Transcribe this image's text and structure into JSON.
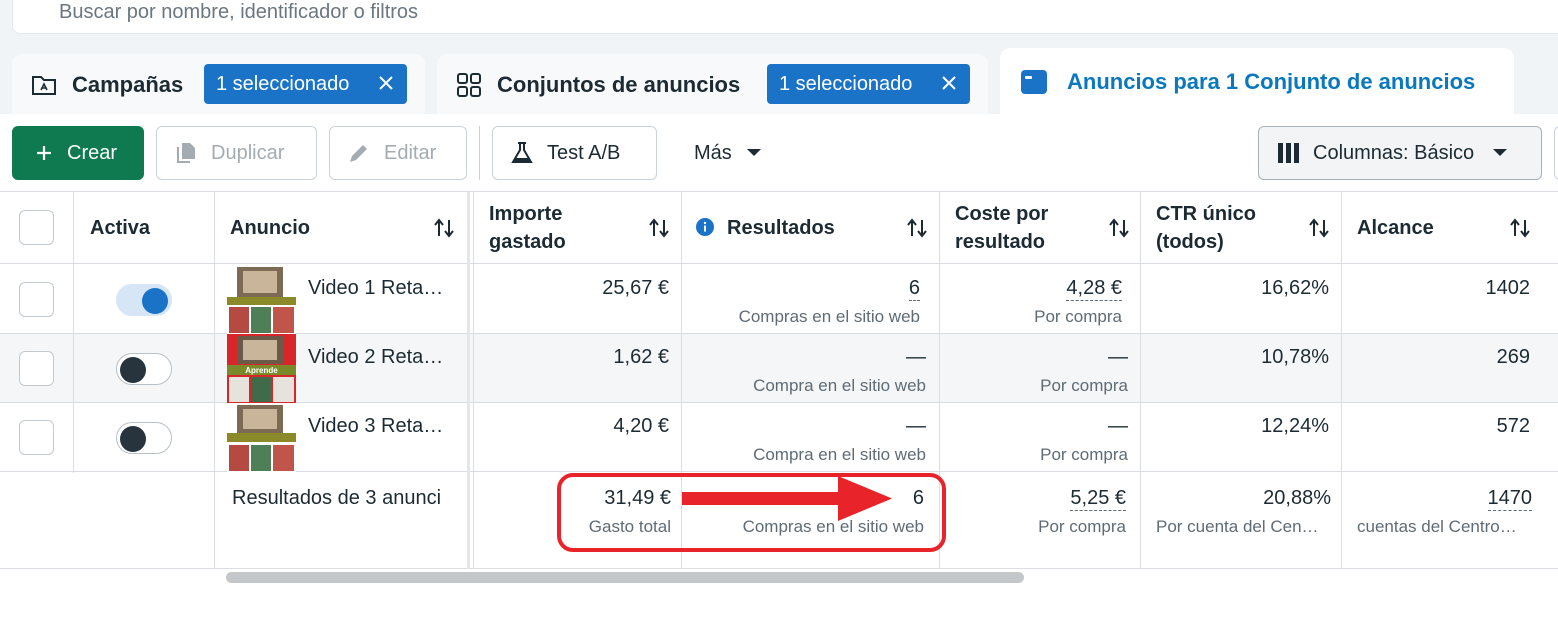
{
  "search": {
    "placeholder": "Buscar por nombre, identificador o filtros"
  },
  "tabs": [
    {
      "label": "Campañas",
      "badge": "1 seleccionado",
      "icon": "folder-icon"
    },
    {
      "label": "Conjuntos de anuncios",
      "badge": "1 seleccionado",
      "icon": "grid-icon"
    },
    {
      "label": "Anuncios para 1 Conjunto de anuncios",
      "icon": "ad-icon"
    }
  ],
  "toolbar": {
    "create": "Crear",
    "duplicate": "Duplicar",
    "edit": "Editar",
    "abtest": "Test A/B",
    "more": "Más",
    "columns": "Columnas: Básico"
  },
  "columns": {
    "active": "Activa",
    "ad": "Anuncio",
    "spend_1": "Importe",
    "spend_2": "gastado",
    "results": "Resultados",
    "cost_1": "Coste por",
    "cost_2": "resultado",
    "ctr_1": "CTR único",
    "ctr_2": "(todos)",
    "reach": "Alcance"
  },
  "rows": [
    {
      "name": "Video 1 Reta…",
      "active": true,
      "spend": "25,67 €",
      "results": "6",
      "results_sub": "Compras en el sitio web",
      "cost": "4,28 €",
      "cost_sub": "Por compra",
      "ctr": "16,62%",
      "reach": "1402"
    },
    {
      "name": "Video 2 Reta…",
      "active": false,
      "spend": "1,62 €",
      "results": "—",
      "results_sub": "Compra en el sitio web",
      "cost": "—",
      "cost_sub": "Por compra",
      "ctr": "10,78%",
      "reach": "269"
    },
    {
      "name": "Video 3 Reta…",
      "active": false,
      "spend": "4,20 €",
      "results": "—",
      "results_sub": "Compra en el sitio web",
      "cost": "—",
      "cost_sub": "Por compra",
      "ctr": "12,24%",
      "reach": "572"
    }
  ],
  "thumb_labels": [
    "Aprende"
  ],
  "totals": {
    "label": "Resultados de 3 anunci",
    "spend": "31,49 €",
    "spend_sub": "Gasto total",
    "results": "6",
    "results_sub": "Compras en el sitio web",
    "cost": "5,25 €",
    "cost_sub": "Por compra",
    "ctr": "20,88%",
    "ctr_sub": "Por cuenta del Cen…",
    "reach": "1470",
    "reach_sub": "cuentas del Centro…"
  },
  "colors": {
    "accent": "#1a73c7",
    "primary": "#0f7a50",
    "annotation": "#e8242a"
  }
}
